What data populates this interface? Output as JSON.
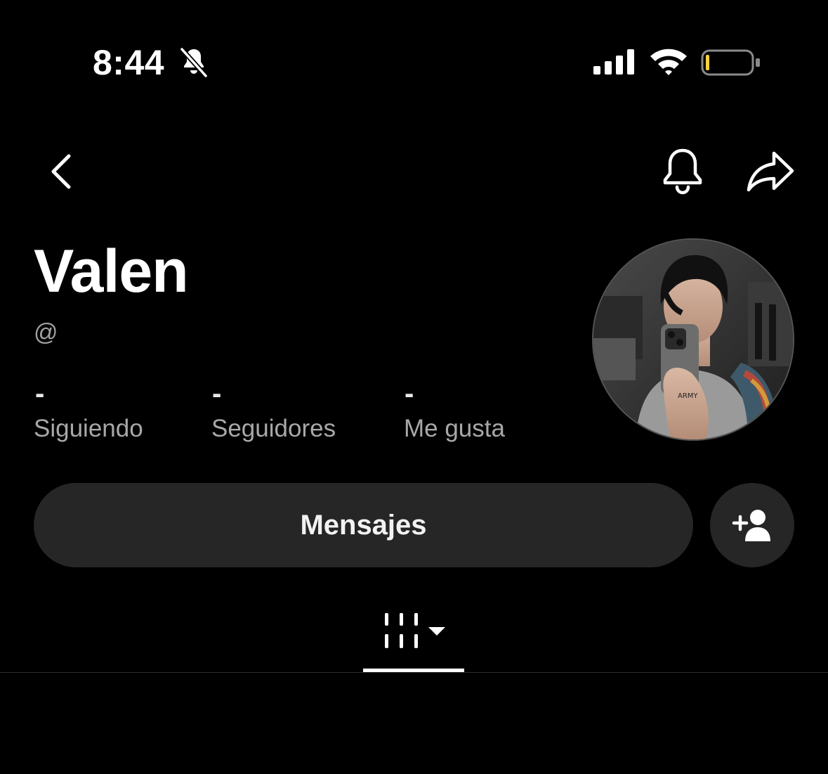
{
  "status_bar": {
    "time": "8:44",
    "mute_icon": "bell-slash-icon",
    "signal_icon": "cellular-signal-icon",
    "wifi_icon": "wifi-icon",
    "battery_icon": "battery-low-icon",
    "battery_level": 0.08,
    "battery_color": "#f5d33b"
  },
  "nav": {
    "back_icon": "chevron-left-icon",
    "bell_icon": "bell-icon",
    "share_icon": "share-arrow-icon"
  },
  "profile": {
    "name": "Valen",
    "handle": "@",
    "stats": [
      {
        "value": "-",
        "label": "Siguiendo"
      },
      {
        "value": "-",
        "label": "Seguidores"
      },
      {
        "value": "-",
        "label": "Me gusta"
      }
    ],
    "avatar_icon": "profile-photo"
  },
  "actions": {
    "messages_label": "Mensajes",
    "add_friend_icon": "add-user-icon"
  },
  "tabs": {
    "videos_icon": "grid-columns-icon",
    "dropdown_icon": "caret-down-icon"
  },
  "colors": {
    "background": "#000000",
    "button_bg": "#262626",
    "secondary_text": "#a8a8a8"
  }
}
